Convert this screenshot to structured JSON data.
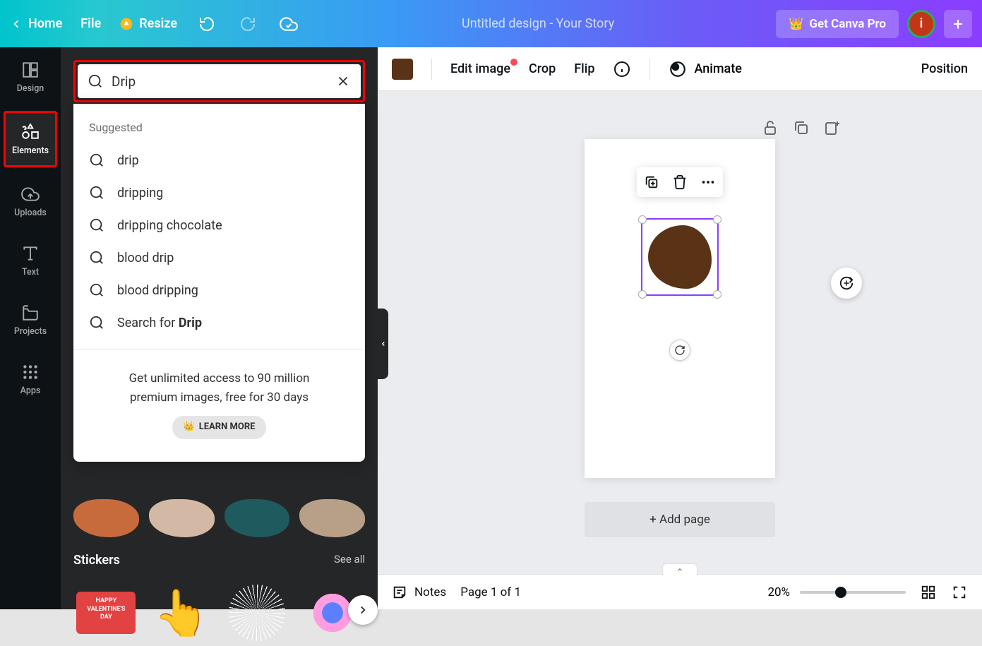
{
  "topbar": {
    "home": "Home",
    "file": "File",
    "resize": "Resize",
    "title": "Untitled design - Your Story",
    "pro": "Get Canva Pro",
    "avatar_initial": "i"
  },
  "siderail": {
    "design": "Design",
    "elements": "Elements",
    "uploads": "Uploads",
    "text": "Text",
    "projects": "Projects",
    "apps": "Apps"
  },
  "search": {
    "value": "Drip",
    "suggested_label": "Suggested",
    "suggestions": [
      "drip",
      "dripping",
      "dripping chocolate",
      "blood drip",
      "blood dripping"
    ],
    "search_for_prefix": "Search for ",
    "search_for_term": "Drip",
    "promo_line1": "Get unlimited access to 90 million",
    "promo_line2": "premium images, free for 30 days",
    "learn_more": "LEARN MORE"
  },
  "panel": {
    "stickers_title": "Stickers",
    "see_all": "See all",
    "valentine_text": "HAPPY VALENTINE'S DAY"
  },
  "toolbar": {
    "edit_image": "Edit image",
    "crop": "Crop",
    "flip": "Flip",
    "animate": "Animate",
    "position": "Position"
  },
  "canvas": {
    "add_page": "+ Add page"
  },
  "bottombar": {
    "notes": "Notes",
    "page_info": "Page 1 of 1",
    "zoom": "20%"
  },
  "colors": {
    "shape_fill": "#5a3215"
  }
}
